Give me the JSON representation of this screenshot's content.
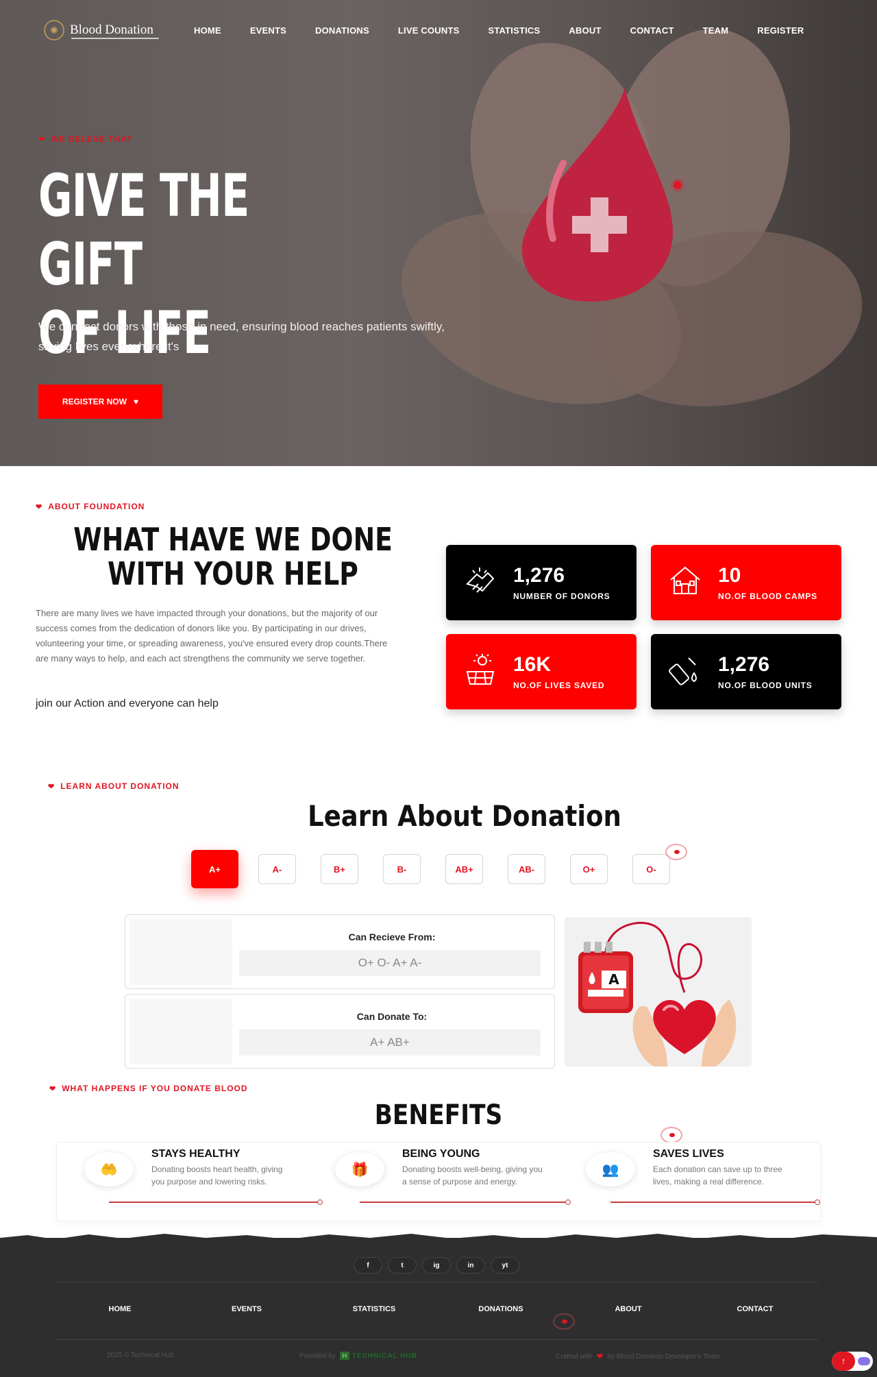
{
  "nav": {
    "logo_text": "Blood Donation",
    "items": [
      "HOME",
      "EVENTS",
      "DONATIONS",
      "LIVE COUNTS",
      "STATISTICS",
      "ABOUT",
      "CONTACT",
      "TEAM",
      "REGISTER"
    ]
  },
  "hero": {
    "tag": "WE BELEVE THAT",
    "title_line1": "GIVE THE GIFT",
    "title_line2": "OF LIFE",
    "text": "We connect donors with those in need, ensuring blood reaches patients swiftly, saving lives everywhere it's",
    "button": "REGISTER NOW"
  },
  "about": {
    "tag": "ABOUT FOUNDATION",
    "title": "WHAT HAVE WE DONE WITH YOUR HELP",
    "text": "There are many lives we have impacted through your donations, but the majority of our success comes from the dedication of donors like you. By participating in our drives, volunteering your time, or spreading awareness, you've ensured every drop counts.There are many ways to help, and each act strengthens the community we serve together.",
    "join": "join our Action and everyone can help",
    "stats": [
      {
        "value": "1,276",
        "label": "NUMBER OF DONORS",
        "icon": "handshake-icon"
      },
      {
        "value": "10",
        "label": "NO.OF BLOOD CAMPS",
        "icon": "house-icon"
      },
      {
        "value": "16K",
        "label": "NO.OF LIVES SAVED",
        "icon": "solar-panel-icon"
      },
      {
        "value": "1,276",
        "label": "NO.OF BLOOD UNITS",
        "icon": "blood-bottle-icon"
      }
    ]
  },
  "learn": {
    "tag": "LEARN ABOUT DONATION",
    "title": "Learn About Donation",
    "groups": [
      "A+",
      "A-",
      "B+",
      "B-",
      "AB+",
      "AB-",
      "O+",
      "O-"
    ],
    "active": "A+",
    "receive_title": "Can Recieve From:",
    "receive_value": "O+ O- A+ A-",
    "donate_title": "Can Donate To:",
    "donate_value": "A+ AB+",
    "bag_letter": "A"
  },
  "benefits": {
    "tag": "WHAT HAPPENS IF YOU DONATE BLOOD",
    "title": "BENEFITS",
    "items": [
      {
        "title": "STAYS HEALTHY",
        "text": "Donating boosts heart health, giving you purpose and lowering risks.",
        "icon": "heart-hands-icon"
      },
      {
        "title": "BEING YOUNG",
        "text": "Donating boosts well-being, giving you a sense of purpose and energy.",
        "icon": "gift-box-icon"
      },
      {
        "title": "SAVES LIVES",
        "text": "Each donation can save up to three lives, making a real difference.",
        "icon": "people-icon"
      }
    ]
  },
  "footer": {
    "social": [
      "f",
      "t",
      "ig",
      "in",
      "yt"
    ],
    "links": [
      "HOME",
      "EVENTS",
      "STATISTICS",
      "DONATIONS",
      "ABOUT",
      "CONTACT"
    ],
    "copyright": "2025 © Technical Hub.",
    "provided_by": "Provided by",
    "provider": "TECHNICAL HUB",
    "crafted_prefix": "Crafted with",
    "crafted_suffix": "by Blood Donation Developer's Team"
  },
  "colors": {
    "accent": "#fe0000",
    "dark": "#000000",
    "footer": "#2e2e2e"
  }
}
